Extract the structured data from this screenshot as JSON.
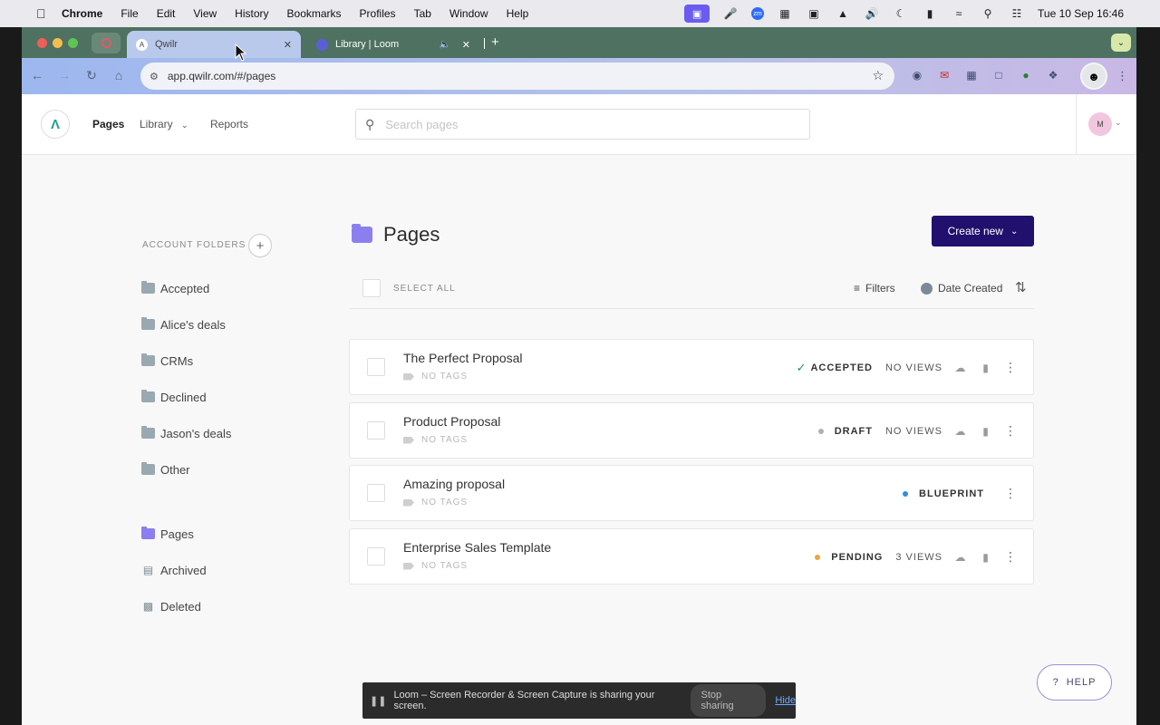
{
  "menubar": {
    "app": "Chrome",
    "items": [
      "File",
      "Edit",
      "View",
      "History",
      "Bookmarks",
      "Profiles",
      "Tab",
      "Window",
      "Help"
    ],
    "datetime": "Tue 10 Sep  16:46"
  },
  "browser": {
    "tabs": [
      {
        "title": "Qwilr",
        "active": true
      },
      {
        "title": "Library | Loom",
        "active": false
      }
    ],
    "url": "app.qwilr.com/#/pages"
  },
  "header": {
    "nav": {
      "pages": "Pages",
      "library": "Library",
      "reports": "Reports"
    },
    "search_placeholder": "Search pages",
    "avatar_initial": "M"
  },
  "sidebar": {
    "account_folders_label": "ACCOUNT FOLDERS",
    "folders": [
      "Accepted",
      "Alice's deals",
      "CRMs",
      "Declined",
      "Jason's deals",
      "Other"
    ],
    "system": [
      "Pages",
      "Archived",
      "Deleted"
    ]
  },
  "main": {
    "title": "Pages",
    "create_button": "Create new",
    "select_all": "SELECT ALL",
    "filters": "Filters",
    "sort": "Date Created",
    "pages": [
      {
        "title": "The Perfect Proposal",
        "tags": "NO TAGS",
        "status": "ACCEPTED",
        "views": "NO VIEWS"
      },
      {
        "title": "Product Proposal",
        "tags": "NO TAGS",
        "status": "DRAFT",
        "views": "NO VIEWS"
      },
      {
        "title": "Amazing proposal",
        "tags": "NO TAGS",
        "status": "BLUEPRINT",
        "views": ""
      },
      {
        "title": "Enterprise Sales Template",
        "tags": "NO TAGS",
        "status": "PENDING",
        "views": "3 VIEWS"
      }
    ]
  },
  "loom": {
    "message": "Loom – Screen Recorder & Screen Capture is sharing your screen.",
    "stop": "Stop sharing",
    "hide": "Hide"
  },
  "help": {
    "label": "HELP",
    "glyph": "?"
  },
  "colors": {
    "accent": "#21106e",
    "accepted": "#2a8f6a",
    "draft": "#b0b0b0",
    "blueprint": "#2f8ee0",
    "pending": "#f0a442",
    "folder_purple": "#8b7ff0"
  }
}
